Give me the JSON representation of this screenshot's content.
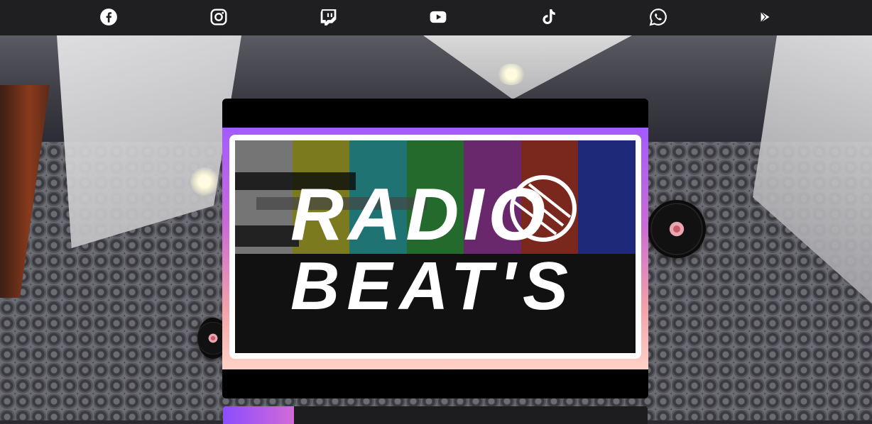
{
  "social": {
    "items": [
      {
        "name": "facebook-icon"
      },
      {
        "name": "instagram-icon"
      },
      {
        "name": "twitch-icon"
      },
      {
        "name": "youtube-icon"
      },
      {
        "name": "tiktok-icon"
      },
      {
        "name": "whatsapp-icon"
      },
      {
        "name": "google-play-icon"
      }
    ],
    "icon_color": "#ffffff",
    "bar_color": "#1f1f22"
  },
  "logo": {
    "line1": "RADIO",
    "line2": "BEAT'S",
    "frame_gradient": [
      "#a35bff",
      "#f2a2a8",
      "#ffd2c6"
    ]
  }
}
